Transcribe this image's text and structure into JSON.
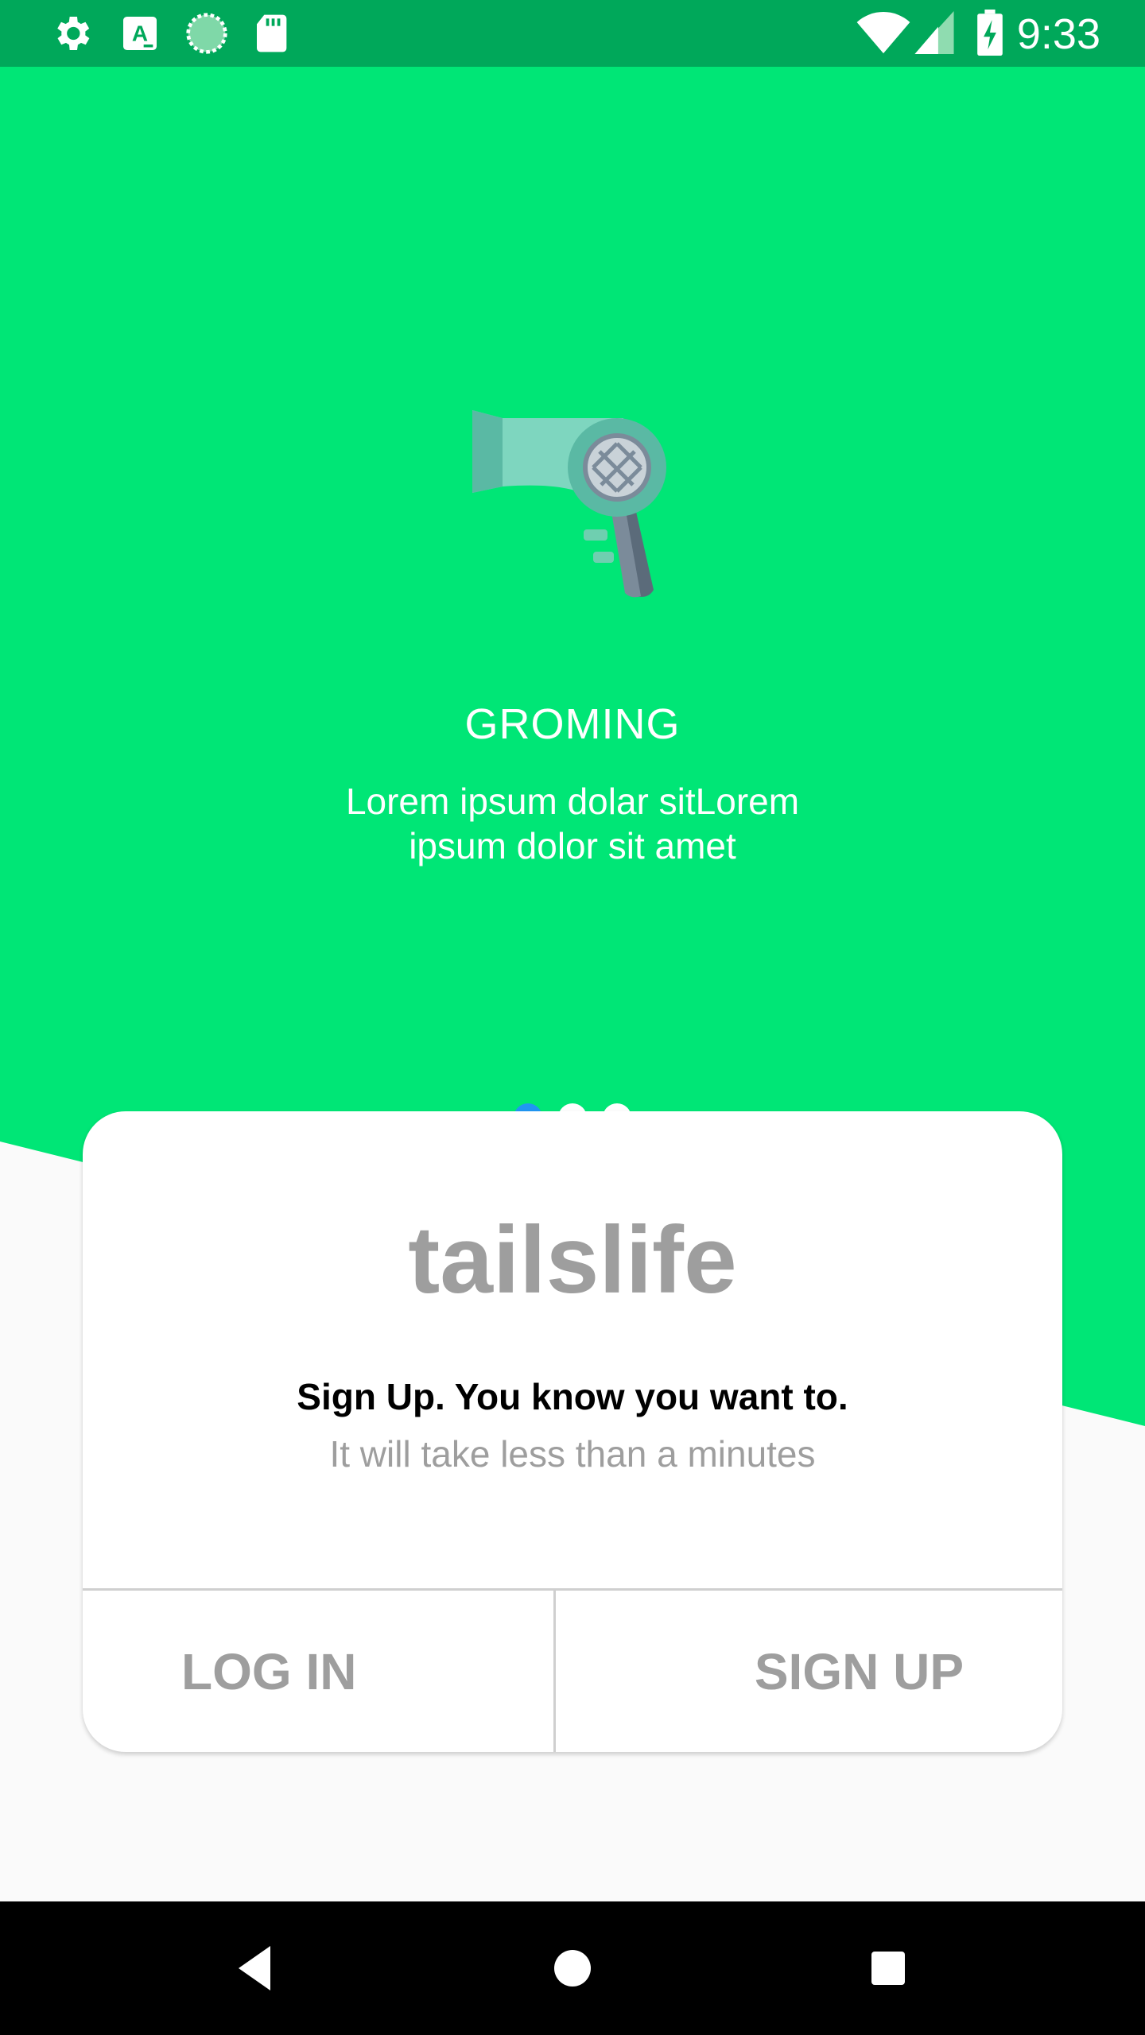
{
  "status_bar": {
    "time": "9:33",
    "left_icons": [
      "gear-icon",
      "text-a-icon",
      "sync-circle-icon",
      "sd-card-icon"
    ],
    "right_icons": [
      "wifi-icon",
      "cell-signal-icon",
      "battery-charging-icon"
    ]
  },
  "onboarding": {
    "illustration": "hair-dryer-icon",
    "title": "GROMING",
    "description_line1": "Lorem ipsum dolar sitLorem",
    "description_line2": "ipsum dolor sit amet",
    "page_indicator": {
      "count": 3,
      "active_index": 0
    }
  },
  "card": {
    "brand": "tailslife",
    "headline": "Sign Up. You know you want to.",
    "subline": "It will take less than a minutes",
    "login_label": "LOG IN",
    "signup_label": "SIGN UP"
  },
  "nav_bar": {
    "buttons": [
      "back-icon",
      "home-icon",
      "recents-icon"
    ]
  },
  "colors": {
    "accent_green": "#00e676",
    "status_bar_green": "#00a85a",
    "active_dot": "#2196f3",
    "muted_text": "#9e9e9e"
  }
}
